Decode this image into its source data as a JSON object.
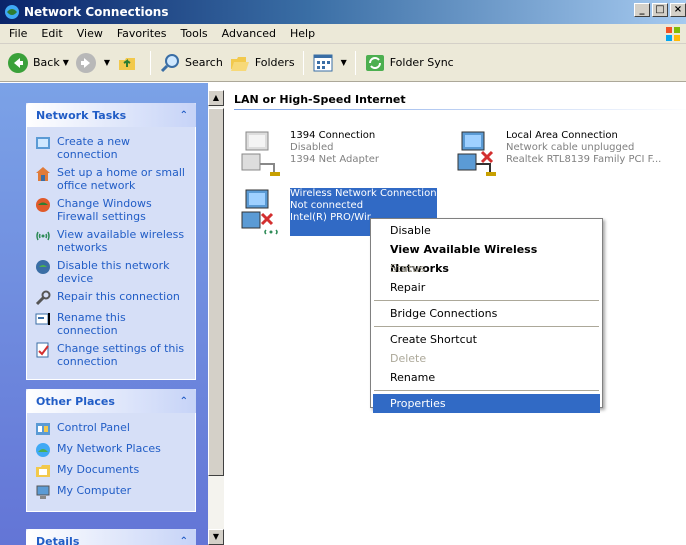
{
  "window": {
    "title": "Network Connections"
  },
  "menubar": {
    "items": [
      "File",
      "Edit",
      "View",
      "Favorites",
      "Tools",
      "Advanced",
      "Help"
    ]
  },
  "toolbar": {
    "back": "Back",
    "search": "Search",
    "folders": "Folders",
    "folder_sync": "Folder Sync"
  },
  "network_tasks": {
    "title": "Network Tasks",
    "items": [
      "Create a new connection",
      "Set up a home or small office network",
      "Change Windows Firewall settings",
      "View available wireless networks",
      "Disable this network device",
      "Repair this connection",
      "Rename this connection",
      "Change settings of this connection"
    ]
  },
  "other_places": {
    "title": "Other Places",
    "items": [
      "Control Panel",
      "My Network Places",
      "My Documents",
      "My Computer"
    ]
  },
  "details": {
    "title": "Details"
  },
  "main": {
    "group_title": "LAN or High-Speed Internet",
    "connections": [
      {
        "name": "1394 Connection",
        "status": "Disabled",
        "device": "1394 Net Adapter"
      },
      {
        "name": "Local Area Connection",
        "status": "Network cable unplugged",
        "device": "Realtek RTL8139 Family PCI F..."
      },
      {
        "name": "Wireless Network Connection",
        "status": "Not connected",
        "device": "Intel(R) PRO/Wir"
      }
    ]
  },
  "context_menu": {
    "items": [
      {
        "label": "Disable",
        "style": "normal"
      },
      {
        "label": "View Available Wireless Networks",
        "style": "bold"
      },
      {
        "label": "Status",
        "style": "disabled"
      },
      {
        "label": "Repair",
        "style": "normal"
      },
      {
        "label": "Bridge Connections",
        "style": "normal"
      },
      {
        "label": "Create Shortcut",
        "style": "normal"
      },
      {
        "label": "Delete",
        "style": "disabled"
      },
      {
        "label": "Rename",
        "style": "normal"
      },
      {
        "label": "Properties",
        "style": "highlight"
      }
    ]
  },
  "colors": {
    "titlebar": "#0a246a",
    "selection": "#316ac5",
    "task_link": "#215dc6",
    "taskpane_bg": "#6375d6"
  }
}
